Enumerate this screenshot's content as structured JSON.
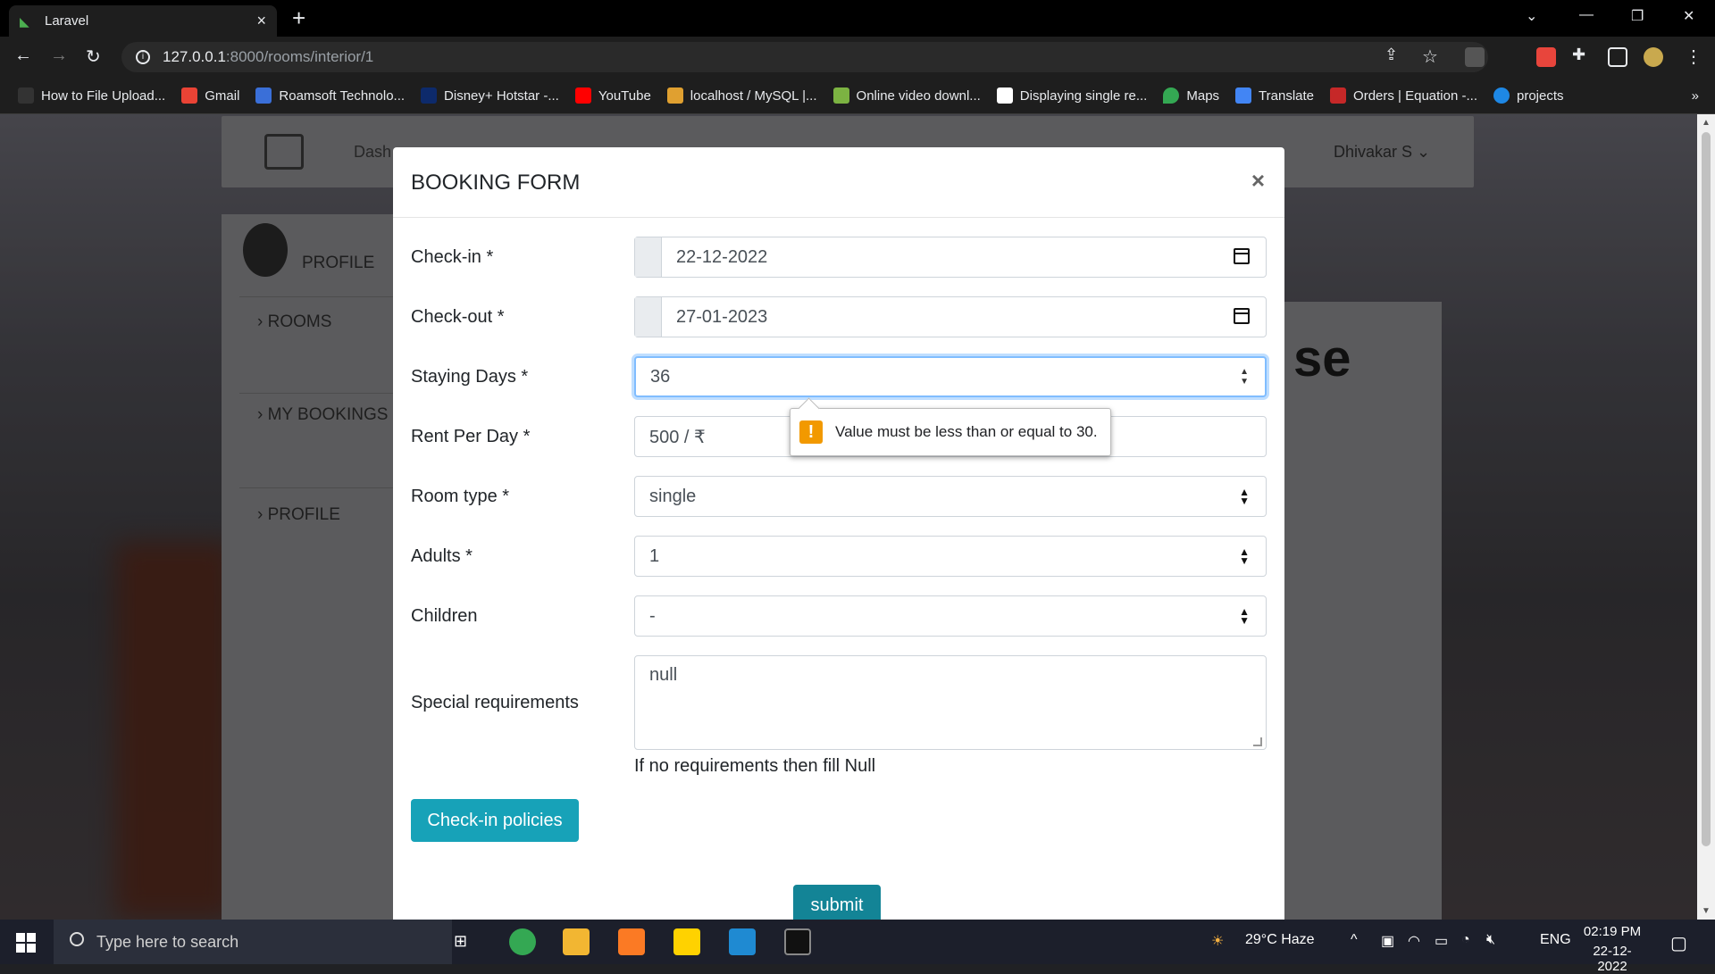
{
  "browser": {
    "tab_title": "Laravel",
    "url_host": "127.0.0.1",
    "url_path": ":8000/rooms/interior/1",
    "bookmarks": [
      "How to File Upload...",
      "Gmail",
      "Roamsoft Technolo...",
      "Disney+ Hotstar -...",
      "YouTube",
      "localhost / MySQL |...",
      "Online video downl...",
      "Displaying single re...",
      "Maps",
      "Translate",
      "Orders | Equation -...",
      "projects"
    ],
    "more_bookmarks": "»"
  },
  "app": {
    "nav_dashboard": "Dash",
    "nav_user": "Dhivakar S ⌄",
    "sidebar": [
      "PROFILE",
      "ROOMS",
      "MY BOOKINGS",
      "PROFILE"
    ],
    "bg_heading": "se"
  },
  "modal": {
    "title": "BOOKING FORM",
    "close": "×",
    "fields": {
      "checkin_label": "Check-in *",
      "checkin_value": "22-12-2022",
      "checkout_label": "Check-out *",
      "checkout_value": "27-01-2023",
      "days_label": "Staying Days *",
      "days_value": "36",
      "rent_label": "Rent Per Day *",
      "rent_value": "500 / ₹",
      "roomtype_label": "Room type *",
      "roomtype_value": "single",
      "adults_label": "Adults *",
      "adults_value": "1",
      "children_label": "Children",
      "children_value": "-",
      "special_label": "Special requirements",
      "special_value": "null",
      "special_help": "If no requirements then fill Null"
    },
    "policies_button": "Check-in policies",
    "submit_button": "submit",
    "validation_tooltip": "Value must be less than or equal to 30."
  },
  "taskbar": {
    "search_placeholder": "Type here to search",
    "weather": "29°C  Haze",
    "lang": "ENG",
    "time": "02:19 PM",
    "date": "22-12-2022"
  },
  "colors": {
    "info_button": "#17a2b8",
    "submit_button": "#138496",
    "warn": "#f29900"
  }
}
